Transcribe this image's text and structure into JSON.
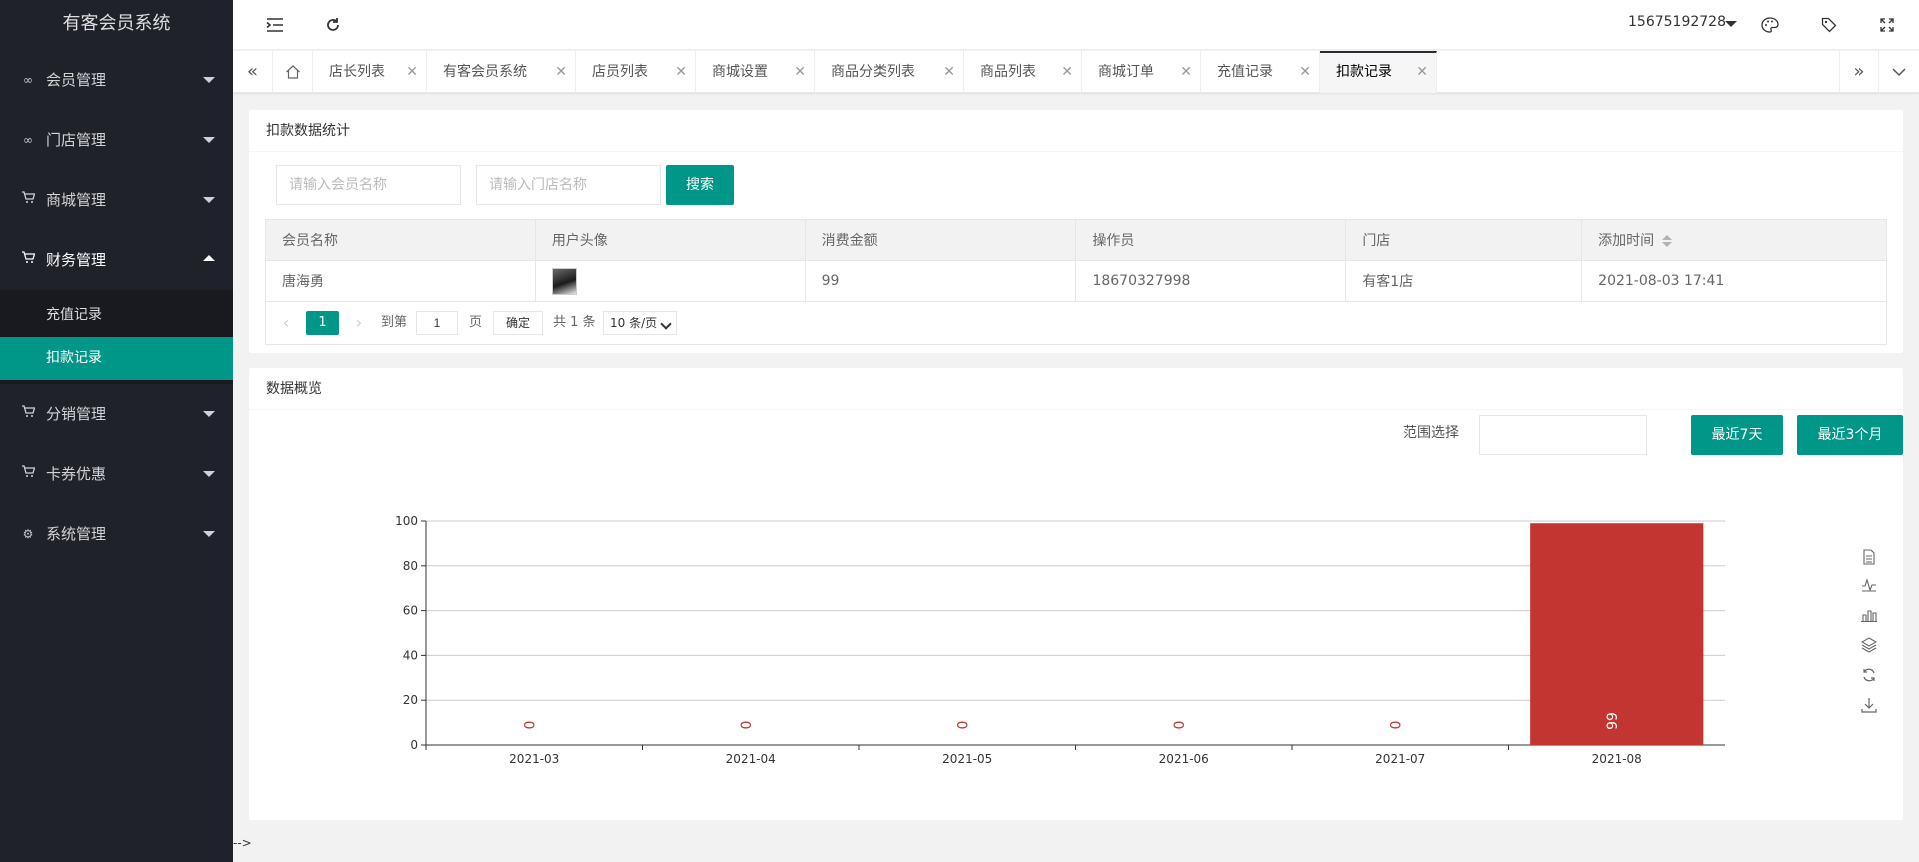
{
  "app": {
    "title": "有客会员系统"
  },
  "sidebar": {
    "items": [
      {
        "label": "会员管理",
        "icon": "link-icon"
      },
      {
        "label": "门店管理",
        "icon": "link-icon"
      },
      {
        "label": "商城管理",
        "icon": "cart-icon"
      },
      {
        "label": "财务管理",
        "icon": "cart-icon",
        "open": true,
        "children": [
          {
            "label": "充值记录"
          },
          {
            "label": "扣款记录",
            "active": true
          }
        ]
      },
      {
        "label": "分销管理",
        "icon": "cart-icon"
      },
      {
        "label": "卡券优惠",
        "icon": "cart-icon"
      },
      {
        "label": "系统管理",
        "icon": "gear-icon"
      }
    ]
  },
  "header": {
    "user": "15675192728"
  },
  "tabs": [
    {
      "label": "店长列表"
    },
    {
      "label": "有客会员系统"
    },
    {
      "label": "店员列表"
    },
    {
      "label": "商城设置"
    },
    {
      "label": "商品分类列表"
    },
    {
      "label": "商品列表"
    },
    {
      "label": "商城订单"
    },
    {
      "label": "充值记录"
    },
    {
      "label": "扣款记录",
      "active": true
    }
  ],
  "stats": {
    "title": "扣款数据统计",
    "member_placeholder": "请输入会员名称",
    "store_placeholder": "请输入门店名称",
    "search_label": "搜索",
    "columns": [
      "会员名称",
      "用户头像",
      "消费金额",
      "操作员",
      "门店",
      "添加时间"
    ],
    "rows": [
      {
        "member": "唐海勇",
        "amount": "99",
        "operator": "18670327998",
        "store": "有客1店",
        "time": "2021-08-03 17:41"
      }
    ],
    "pager": {
      "current": "1",
      "goto_label": "到第",
      "goto_value": "1",
      "page_label": "页",
      "confirm": "确定",
      "total": "共 1 条",
      "per_page": "10 条/页"
    }
  },
  "overview": {
    "title": "数据概览",
    "range_label": "范围选择",
    "range_value": "",
    "btn_7days": "最近7天",
    "btn_3months": "最近3个月"
  },
  "footer_note": "-->",
  "colors": {
    "accent": "#009688",
    "bar": "#c23531",
    "sidebar": "#20222a"
  },
  "chart_data": {
    "type": "bar",
    "categories": [
      "2021-03",
      "2021-04",
      "2021-05",
      "2021-06",
      "2021-07",
      "2021-08"
    ],
    "values": [
      0,
      0,
      0,
      0,
      0,
      99
    ],
    "data_labels": [
      "0",
      "0",
      "0",
      "0",
      "0",
      "99"
    ],
    "ylim": [
      0,
      100
    ],
    "yticks": [
      0,
      20,
      40,
      60,
      80,
      100
    ],
    "grid": true,
    "title": "",
    "xlabel": "",
    "ylabel": "",
    "toolbox": [
      "data-view-icon",
      "line-icon",
      "bar-icon",
      "stack-icon",
      "restore-icon",
      "download-icon"
    ]
  }
}
